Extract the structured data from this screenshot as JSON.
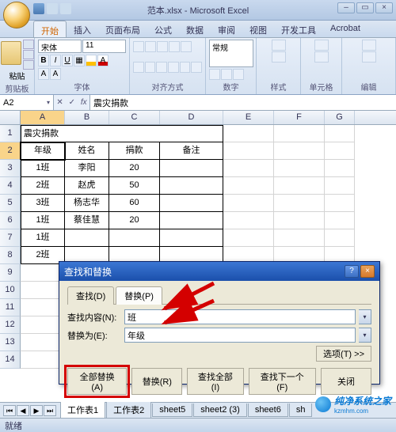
{
  "window": {
    "title": "范本.xlsx - Microsoft Excel"
  },
  "ribbon": {
    "tabs": [
      "开始",
      "插入",
      "页面布局",
      "公式",
      "数据",
      "审阅",
      "视图",
      "开发工具",
      "Acrobat"
    ],
    "active_tab": "开始",
    "font_name": "宋体",
    "font_size": "11",
    "number_format": "常规",
    "groups": {
      "clipboard": "剪贴板",
      "font": "字体",
      "alignment": "对齐方式",
      "number": "数字",
      "styles": "样式",
      "cells": "单元格",
      "editing": "编辑"
    },
    "paste": "粘贴"
  },
  "formula_bar": {
    "name_box": "A2",
    "formula": "震灾捐款"
  },
  "columns": [
    "A",
    "B",
    "C",
    "D",
    "E",
    "F",
    "G"
  ],
  "table": {
    "title": "震灾捐款",
    "headers": [
      "年级",
      "姓名",
      "捐款",
      "备注"
    ],
    "rows": [
      [
        "1班",
        "李阳",
        "20",
        ""
      ],
      [
        "2班",
        "赵虎",
        "50",
        ""
      ],
      [
        "3班",
        "杨志华",
        "60",
        ""
      ],
      [
        "1班",
        "蔡佳慧",
        "20",
        ""
      ],
      [
        "1班",
        "",
        "",
        ""
      ],
      [
        "2班",
        "",
        "",
        ""
      ]
    ]
  },
  "dialog": {
    "title": "查找和替换",
    "tabs": [
      "查找(D)",
      "替换(P)"
    ],
    "active_tab": "替换(P)",
    "find_label": "查找内容(N):",
    "find_value": "班",
    "replace_label": "替换为(E):",
    "replace_value": "年级",
    "options_btn": "选项(T) >>",
    "buttons": {
      "replace_all": "全部替换(A)",
      "replace": "替换(R)",
      "find_all": "查找全部(I)",
      "find_next": "查找下一个(F)",
      "close": "关闭"
    }
  },
  "sheet_tabs": [
    "工作表1",
    "工作表2",
    "sheet5",
    "sheet2 (3)",
    "sheet6",
    "sh"
  ],
  "statusbar": {
    "ready": "就绪"
  },
  "watermark": {
    "text": "纯净系统之家",
    "url": "kzmhm.com"
  }
}
